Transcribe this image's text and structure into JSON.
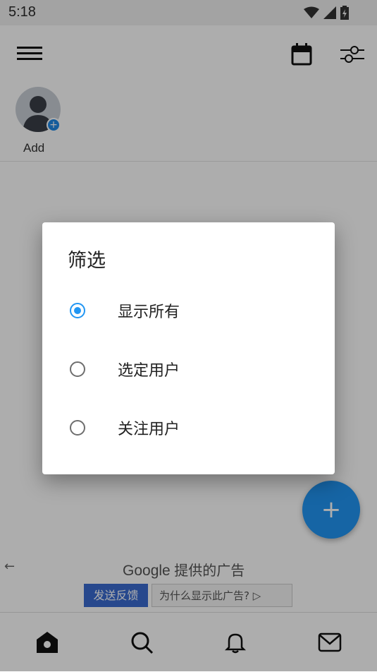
{
  "status_bar": {
    "time": "5:18"
  },
  "stories": {
    "add_label": "Add"
  },
  "ad": {
    "provider_brand": "Google",
    "provider_suffix": "提供的广告",
    "feedback_button": "发送反馈",
    "why_button": "为什么显示此广告?"
  },
  "dialog": {
    "title": "筛选",
    "options": [
      {
        "label": "显示所有",
        "selected": true
      },
      {
        "label": "选定用户",
        "selected": false
      },
      {
        "label": "关注用户",
        "selected": false
      }
    ]
  },
  "colors": {
    "accent": "#2196f3",
    "scrim": "rgba(0,0,0,0.32)"
  },
  "icons": [
    "menu-icon",
    "calendar-icon",
    "filter-sliders-icon",
    "home-icon",
    "search-icon",
    "bell-icon",
    "mail-icon",
    "plus-icon"
  ]
}
